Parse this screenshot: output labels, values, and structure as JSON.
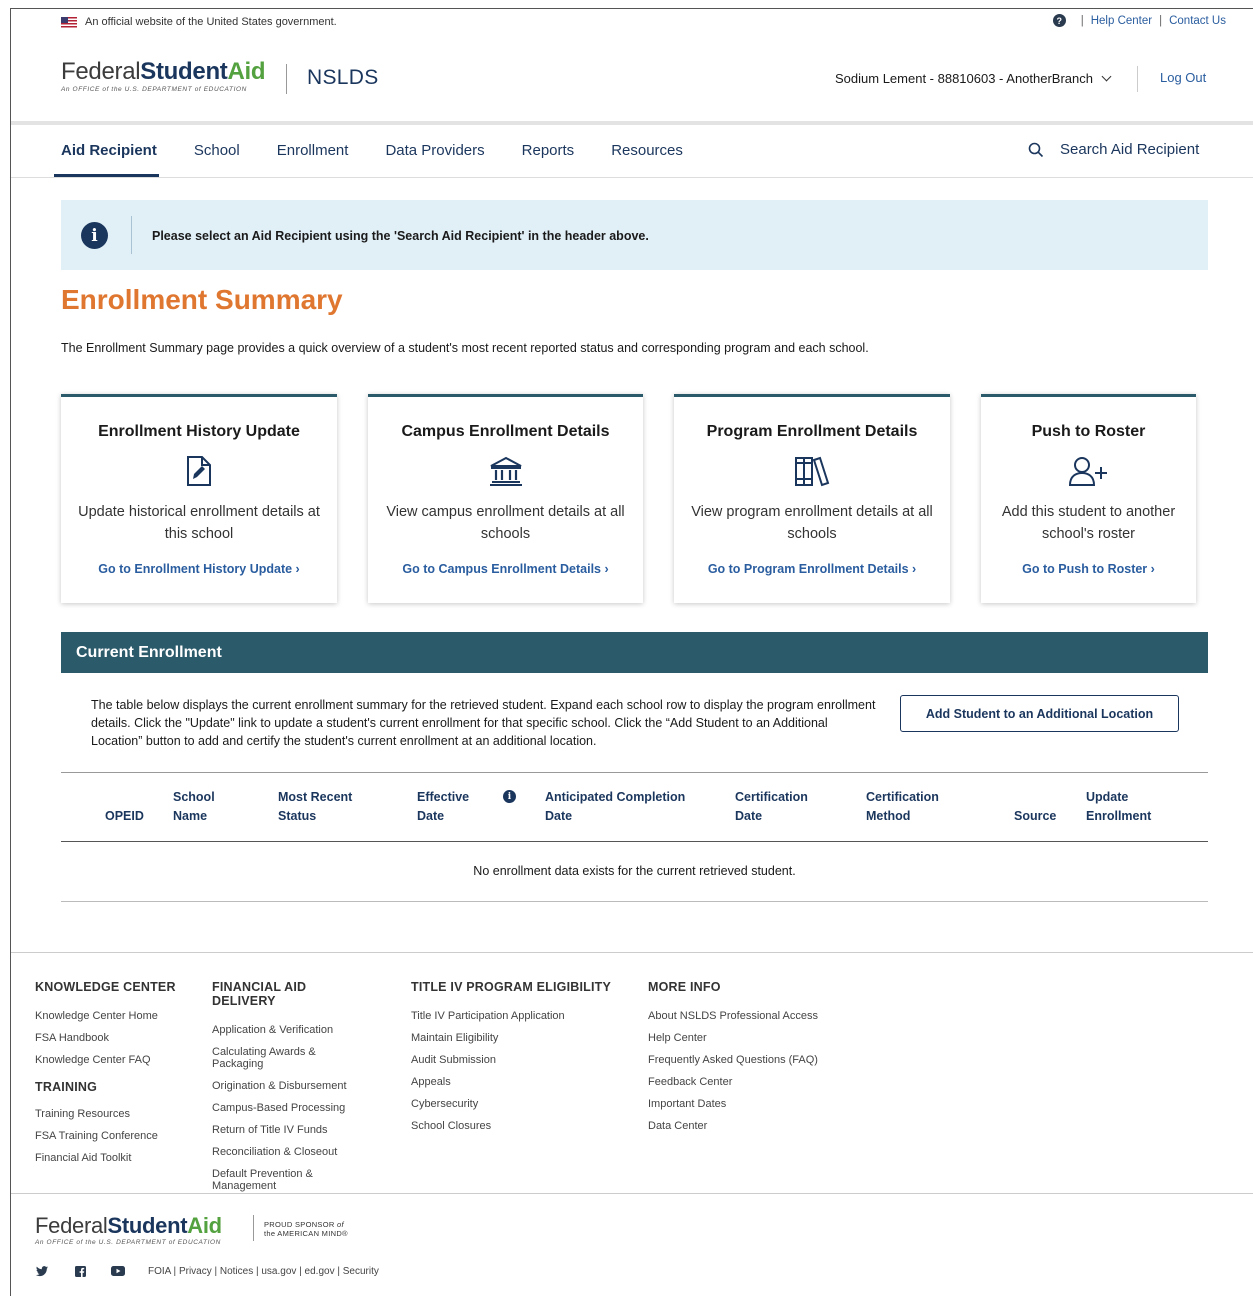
{
  "gov_banner": {
    "text": "An official website of the United States government."
  },
  "utility": {
    "help": "Help Center",
    "separator": "|",
    "contact": "Contact Us"
  },
  "header": {
    "brand_plain": "Federal",
    "brand_student": "Student",
    "brand_aid": "Aid",
    "brand_sub": "An OFFICE of the U.S. DEPARTMENT of EDUCATION",
    "app_name": "NSLDS",
    "user": "Sodium Lement - 88810603 - AnotherBranch",
    "logout": "Log Out"
  },
  "nav": {
    "items": [
      "Aid Recipient",
      "School",
      "Enrollment",
      "Data Providers",
      "Reports",
      "Resources"
    ],
    "active_index": 0,
    "search": "Search Aid Recipient"
  },
  "alert": {
    "icon": "i",
    "text": "Please select an Aid Recipient using the 'Search Aid Recipient' in the header above."
  },
  "page": {
    "title": "Enrollment Summary",
    "description": "The Enrollment Summary page provides a quick overview of a student's most recent reported status and corresponding program and each school."
  },
  "cards": [
    {
      "title": "Enrollment History Update",
      "icon": "edit-document-icon",
      "desc": "Update historical enrollment details at this school",
      "link": "Go to Enrollment History Update ›"
    },
    {
      "title": "Campus Enrollment Details",
      "icon": "institution-icon",
      "desc": "View campus enrollment details at all schools",
      "link": "Go to Campus Enrollment Details ›"
    },
    {
      "title": "Program Enrollment Details",
      "icon": "books-icon",
      "desc": "View program enrollment details at all schools",
      "link": "Go to Program Enrollment Details ›"
    },
    {
      "title": "Push to Roster",
      "icon": "add-user-icon",
      "desc": "Add this student to another school's roster",
      "link": "Go to Push to Roster ›"
    }
  ],
  "current_enrollment": {
    "title": "Current Enrollment",
    "description": "The table below displays the current enrollment summary for the retrieved student. Expand each school row to display the program enrollment details. Click the \"Update\" link to update a student's current enrollment for that specific school. Click the “Add Student to an Additional Location” button to add and certify the student's current enrollment at an additional location.",
    "add_button": "Add Student to an Additional Location",
    "columns": {
      "opeid": "OPEID",
      "school_name_1": "School",
      "school_name_2": "Name",
      "status_1": "Most Recent",
      "status_2": "Status",
      "effective_1": "Effective",
      "effective_2": "Date",
      "info_icon": "i",
      "anticipated_1": "Anticipated Completion",
      "anticipated_2": "Date",
      "cert_date_1": "Certification",
      "cert_date_2": "Date",
      "cert_method_1": "Certification",
      "cert_method_2": "Method",
      "source": "Source",
      "update_1": "Update",
      "update_2": "Enrollment"
    },
    "empty_message": "No enrollment data exists for the current retrieved student."
  },
  "footer": {
    "knowledge_center": {
      "heading": "KNOWLEDGE CENTER",
      "items": [
        "Knowledge Center Home",
        "FSA Handbook",
        "Knowledge Center FAQ"
      ]
    },
    "training": {
      "heading": "TRAINING",
      "items": [
        "Training Resources",
        "FSA Training Conference",
        "Financial Aid Toolkit"
      ]
    },
    "financial_aid_delivery": {
      "heading": "FINANCIAL AID DELIVERY",
      "items": [
        "Application & Verification",
        "Calculating Awards & Packaging",
        "Origination & Disbursement",
        "Campus-Based Processing",
        "Return of Title IV Funds",
        "Reconciliation & Closeout",
        "Default Prevention & Management"
      ]
    },
    "title_iv": {
      "heading": "TITLE IV PROGRAM ELIGIBILITY",
      "items": [
        "Title IV Participation Application",
        "Maintain Eligibility",
        "Audit Submission",
        "Appeals",
        "Cybersecurity",
        "School Closures"
      ]
    },
    "more_info": {
      "heading": "MORE INFO",
      "items": [
        "About NSLDS Professional Access",
        "Help Center",
        "Frequently Asked Questions (FAQ)",
        "Feedback Center",
        "Important Dates",
        "Data Center"
      ]
    },
    "sponsor_1": "PROUD SPONSOR",
    "sponsor_of": "of",
    "sponsor_2": "the AMERICAN MIND®",
    "social": [
      "twitter-icon",
      "facebook-icon",
      "youtube-icon"
    ],
    "legal": "FOIA | Privacy | Notices | usa.gov | ed.gov | Security"
  },
  "colors": {
    "navy": "#1b365d",
    "teal": "#2b5a6b",
    "orange": "#e07730",
    "link": "#2a5d9f",
    "green": "#53a13f",
    "alert_bg": "#e1eff7"
  }
}
